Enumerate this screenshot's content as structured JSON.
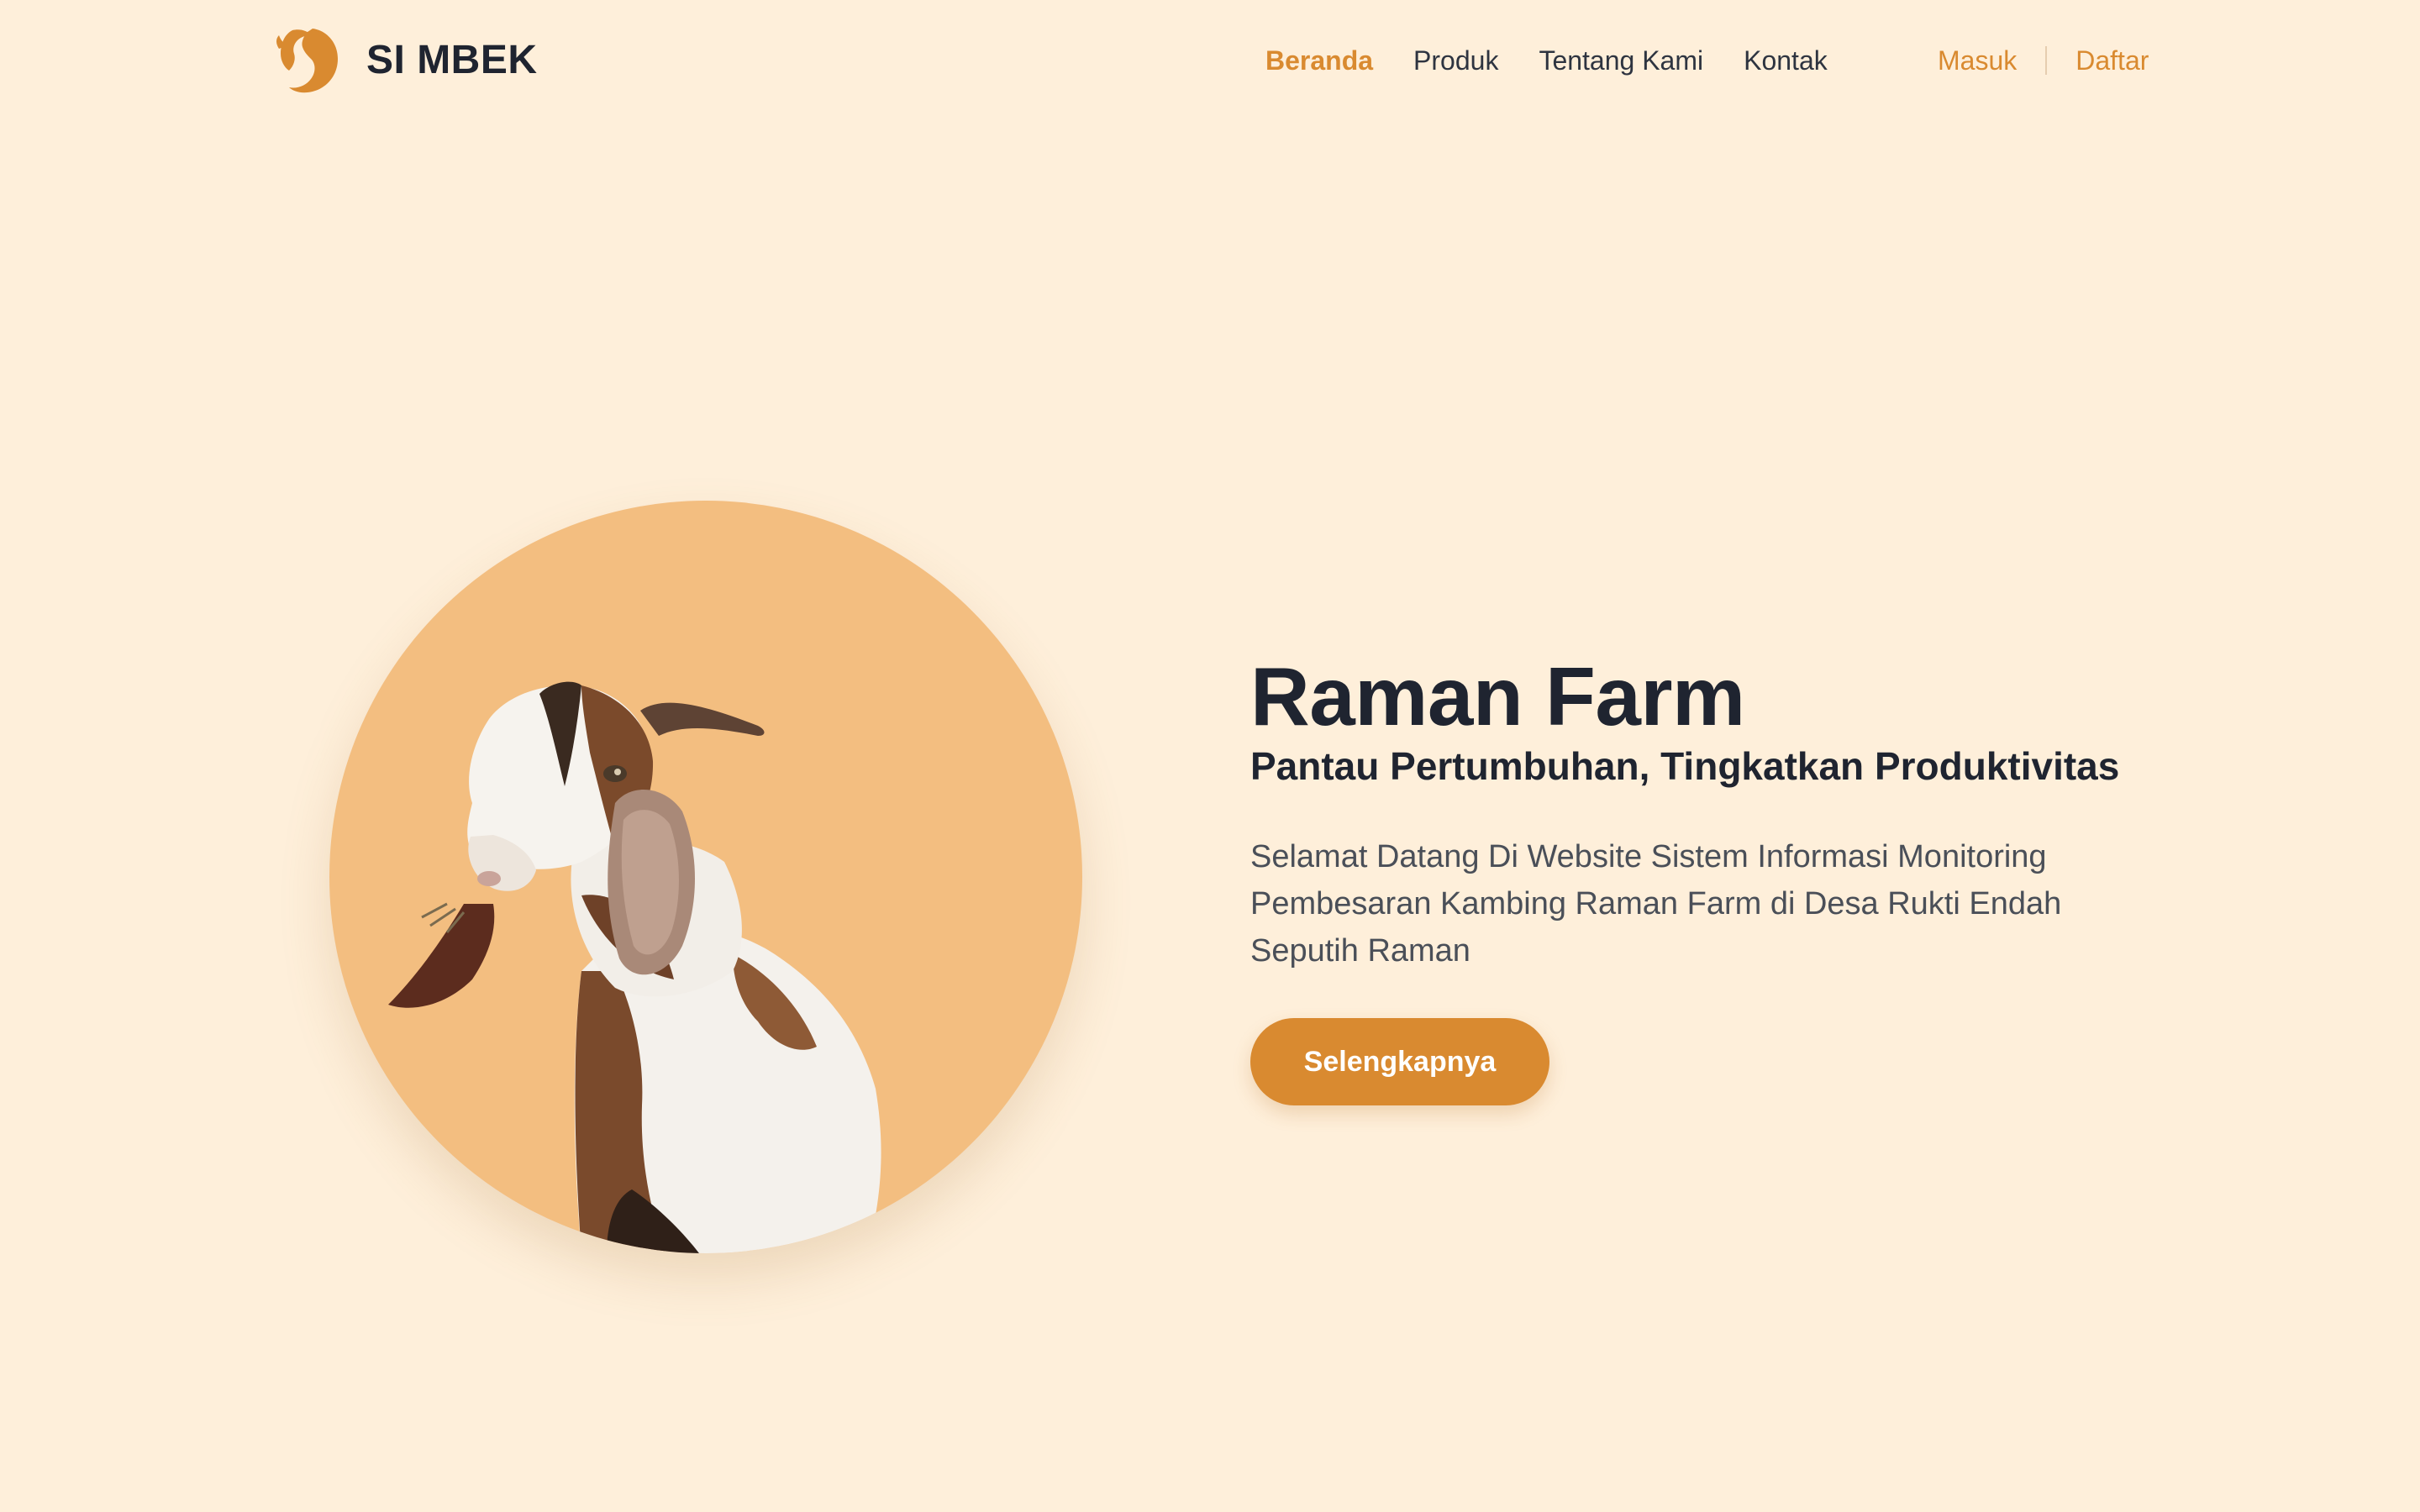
{
  "brand": {
    "name": "SI MBEK",
    "logo_icon": "goat-head-icon",
    "accent": "#D98A30"
  },
  "nav": {
    "items": [
      {
        "label": "Beranda",
        "active": true
      },
      {
        "label": "Produk",
        "active": false
      },
      {
        "label": "Tentang Kami",
        "active": false
      },
      {
        "label": "Kontak",
        "active": false
      }
    ],
    "login_label": "Masuk",
    "register_label": "Daftar"
  },
  "hero": {
    "title": "Raman Farm",
    "subtitle": "Pantau Pertumbuhan, Tingkatkan Produktivitas",
    "description": "Selamat Datang Di Website Sistem Informasi Monitoring Pembesaran Kambing Raman Farm di Desa Rukti Endah Seputih Raman",
    "cta_label": "Selengkapnya",
    "image": "goat-photo",
    "circle_color": "#F3BE80"
  },
  "colors": {
    "background": "#FEEFDA",
    "text": "#1F2430",
    "accent": "#D98A30"
  }
}
